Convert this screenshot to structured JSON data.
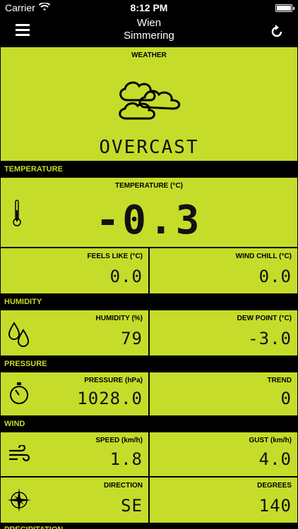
{
  "status": {
    "carrier": "Carrier",
    "time": "8:12 PM"
  },
  "nav": {
    "city": "Wien",
    "district": "Simmering"
  },
  "weather": {
    "label": "WEATHER",
    "condition": "OVERCAST"
  },
  "sections": {
    "temperature": "TEMPERATURE",
    "humidity": "HUMIDITY",
    "pressure": "PRESSURE",
    "wind": "WIND",
    "precipitation": "PRECIPITATION"
  },
  "temperature": {
    "label": "TEMPERATURE (°C)",
    "value": "-0.3"
  },
  "feels_like": {
    "label": "FEELS LIKE (°C)",
    "value": "0.0"
  },
  "wind_chill": {
    "label": "WIND CHILL (°C)",
    "value": "0.0"
  },
  "humidity": {
    "label": "HUMIDITY (%)",
    "value": "79"
  },
  "dew_point": {
    "label": "DEW POINT (°C)",
    "value": "-3.0"
  },
  "pressure": {
    "label": "PRESSURE (hPa)",
    "value": "1028.0"
  },
  "trend": {
    "label": "TREND",
    "value": "0"
  },
  "speed": {
    "label": "SPEED (km/h)",
    "value": "1.8"
  },
  "gust": {
    "label": "GUST (km/h)",
    "value": "4.0"
  },
  "direction": {
    "label": "DIRECTION",
    "value": "SE"
  },
  "degrees": {
    "label": "DEGREES",
    "value": "140"
  },
  "colors": {
    "lcd_green": "#c5dc2a",
    "background": "#000000"
  }
}
